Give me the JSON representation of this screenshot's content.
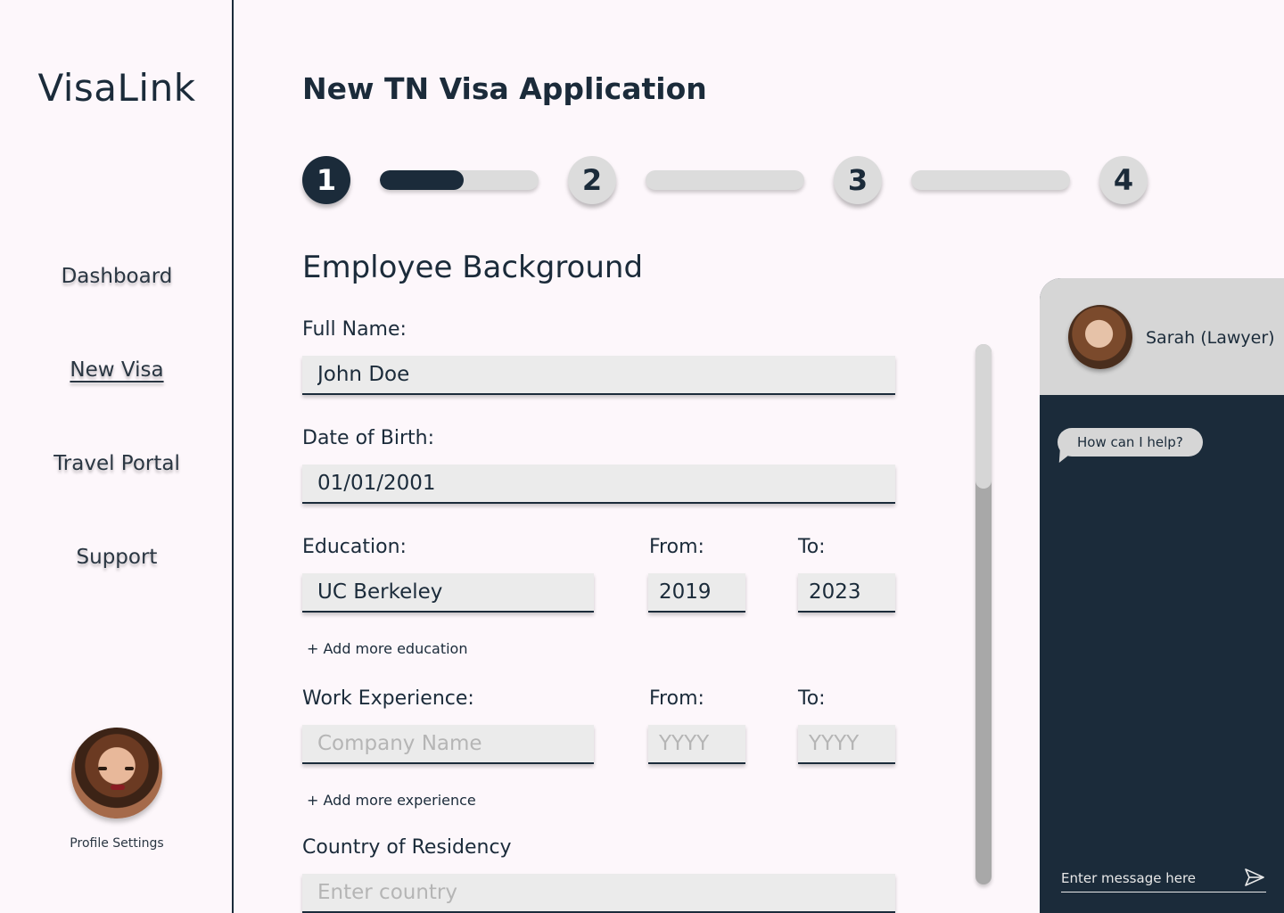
{
  "sidebar": {
    "logo": "VisaLink",
    "nav": [
      "Dashboard",
      "New Visa",
      "Travel Portal",
      "Support"
    ],
    "active_index": 1,
    "profile_label": "Profile Settings"
  },
  "main": {
    "title": "New TN Visa Application",
    "steps": [
      "1",
      "2",
      "3",
      "4"
    ],
    "current_step": 1,
    "step1_progress": 0.53,
    "section_title": "Employee Background",
    "full_name": {
      "label": "Full Name:",
      "value": "John Doe"
    },
    "dob": {
      "label": "Date of Birth:",
      "value": "01/01/2001"
    },
    "education": {
      "label": "Education:",
      "from_label": "From:",
      "to_label": "To:",
      "value": "UC Berkeley",
      "from": "2019",
      "to": "2023",
      "add": "+ Add more education"
    },
    "work": {
      "label": "Work Experience:",
      "from_label": "From:",
      "to_label": "To:",
      "placeholder": "Company Name",
      "from_placeholder": "YYYY",
      "to_placeholder": "YYYY",
      "add": "+ Add more experience"
    },
    "residency": {
      "label": "Country of Residency",
      "placeholder": "Enter country"
    }
  },
  "chat": {
    "lawyer_name": "Sarah (Lawyer)",
    "message": "How can I help?",
    "input_placeholder": "Enter message here",
    "send_icon": "send-icon"
  },
  "colors": {
    "primary": "#1b2b3a",
    "background": "#fdf7fb",
    "field": "#ebebeb",
    "track": "#dcdcdc"
  }
}
